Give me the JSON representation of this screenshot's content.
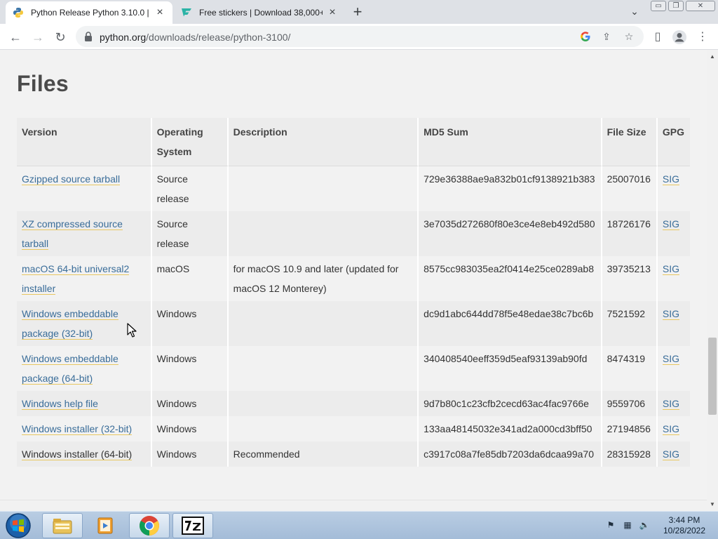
{
  "browser": {
    "tabs": [
      {
        "title": "Python Release Python 3.10.0 | Py",
        "active": true
      },
      {
        "title": "Free stickers | Download 38,000+",
        "active": false
      }
    ],
    "window_buttons": {
      "minimize": "▭",
      "restore": "❐",
      "close": "✕"
    },
    "url": {
      "host": "python.org",
      "path": "/downloads/release/python-3100/"
    }
  },
  "page": {
    "heading": "Files",
    "table": {
      "headers": {
        "version": "Version",
        "os_line1": "Operating",
        "os_line2": "System",
        "description": "Description",
        "md5": "MD5 Sum",
        "size": "File Size",
        "gpg": "GPG"
      },
      "rows": [
        {
          "version": "Gzipped source tarball",
          "os": "Source release",
          "description": "",
          "md5": "729e36388ae9a832b01cf9138921b383",
          "size": "25007016",
          "gpg": "SIG"
        },
        {
          "version": "XZ compressed source tarball",
          "os": "Source release",
          "description": "",
          "md5": "3e7035d272680f80e3ce4e8eb492d580",
          "size": "18726176",
          "gpg": "SIG"
        },
        {
          "version": "macOS 64-bit universal2 installer",
          "os": "macOS",
          "description": "for macOS 10.9 and later (updated for macOS 12 Monterey)",
          "md5": "8575cc983035ea2f0414e25ce0289ab8",
          "size": "39735213",
          "gpg": "SIG"
        },
        {
          "version": "Windows embeddable package (32-bit)",
          "os": "Windows",
          "description": "",
          "md5": "dc9d1abc644dd78f5e48edae38c7bc6b",
          "size": "7521592",
          "gpg": "SIG"
        },
        {
          "version": "Windows embeddable package (64-bit)",
          "os": "Windows",
          "description": "",
          "md5": "340408540eeff359d5eaf93139ab90fd",
          "size": "8474319",
          "gpg": "SIG"
        },
        {
          "version": "Windows help file",
          "os": "Windows",
          "description": "",
          "md5": "9d7b80c1c23cfb2cecd63ac4fac9766e",
          "size": "9559706",
          "gpg": "SIG"
        },
        {
          "version": "Windows installer (32-bit)",
          "os": "Windows",
          "description": "",
          "md5": "133aa48145032e341ad2a000cd3bff50",
          "size": "27194856",
          "gpg": "SIG"
        },
        {
          "version": "Windows installer (64-bit)",
          "os": "Windows",
          "description": "Recommended",
          "md5": "c3917c08a7fe85db7203da6dcaa99a70",
          "size": "28315928",
          "gpg": "SIG"
        }
      ]
    }
  },
  "taskbar": {
    "time": "3:44 PM",
    "date": "10/28/2022"
  },
  "colors": {
    "link": "#3a6d99",
    "link_underline": "#e8c761",
    "heading": "#4b4b4b"
  }
}
